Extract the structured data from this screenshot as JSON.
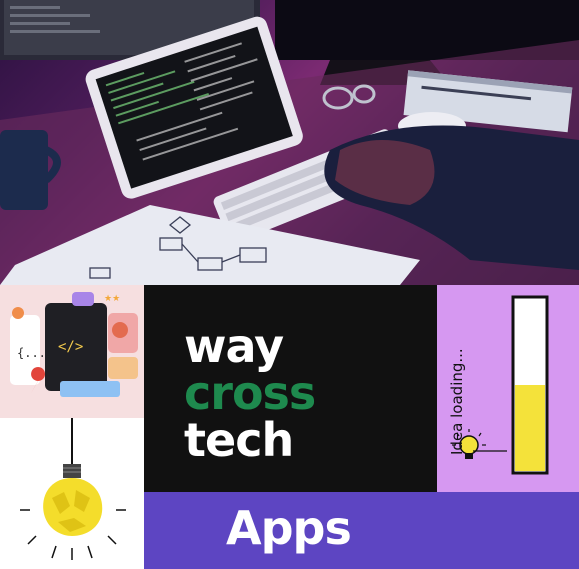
{
  "brand": {
    "line1": "way",
    "line2": "cross",
    "line3": "tech",
    "colors": {
      "white": "#ffffff",
      "green": "#1e8a4e",
      "panel": "#111111"
    }
  },
  "apps": {
    "label": "Apps",
    "color": "#5d45c2"
  },
  "idea": {
    "caption": "Idea loading...",
    "loading_fraction": 0.5,
    "background": "#d698f1"
  },
  "images": {
    "top_photo": "person-typing-on-keyboard-with-tablet-showing-code",
    "left_top": "3d-app-icons-illustration",
    "left_bottom": "crumpled-paper-lightbulb",
    "idea_icon": "lightbulb-icon"
  }
}
